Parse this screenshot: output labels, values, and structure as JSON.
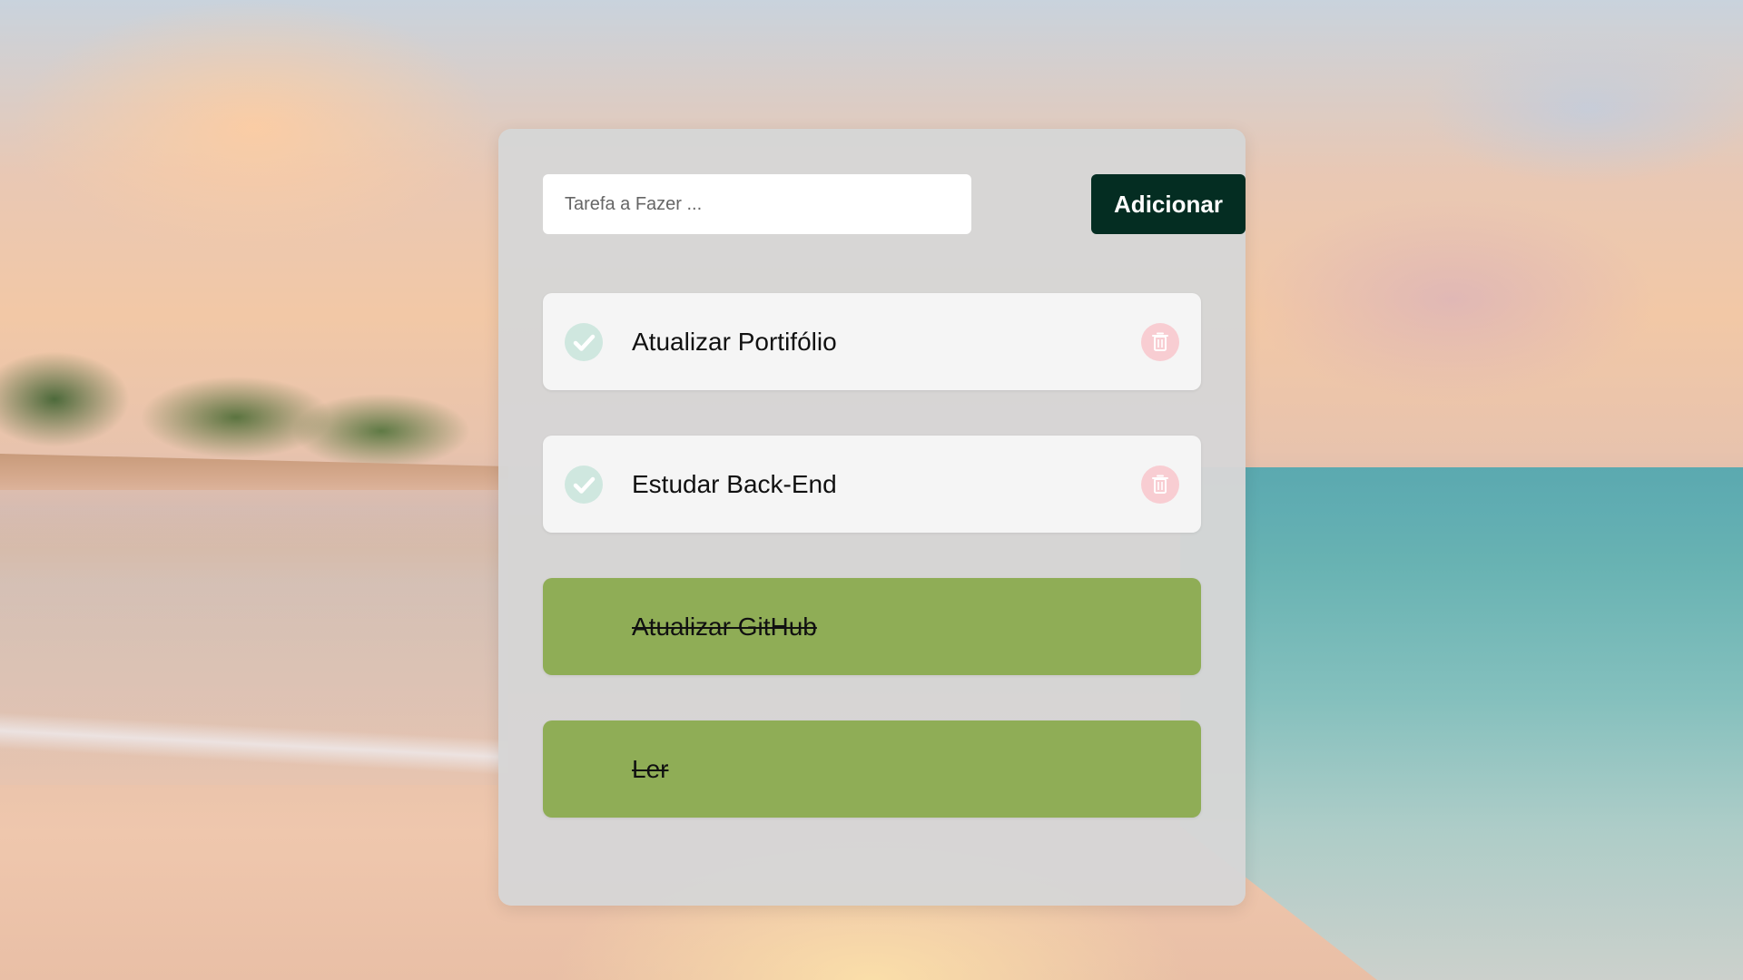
{
  "form": {
    "input_placeholder": "Tarefa a Fazer ...",
    "input_value": "",
    "add_label": "Adicionar"
  },
  "tasks": [
    {
      "text": "Atualizar Portifólio",
      "completed": false,
      "check_icon": "check-circle-icon",
      "delete_icon": "trash-icon"
    },
    {
      "text": "Estudar Back-End",
      "completed": false,
      "check_icon": "check-circle-icon",
      "delete_icon": "trash-icon"
    },
    {
      "text": "Atualizar GitHub",
      "completed": true
    },
    {
      "text": "Ler",
      "completed": true
    }
  ],
  "colors": {
    "add_button": "#042d22",
    "completed_task": "#8fad56",
    "pending_task": "#f5f5f5",
    "check_icon": "#6fc4a6",
    "delete_icon": "#f48a98"
  }
}
